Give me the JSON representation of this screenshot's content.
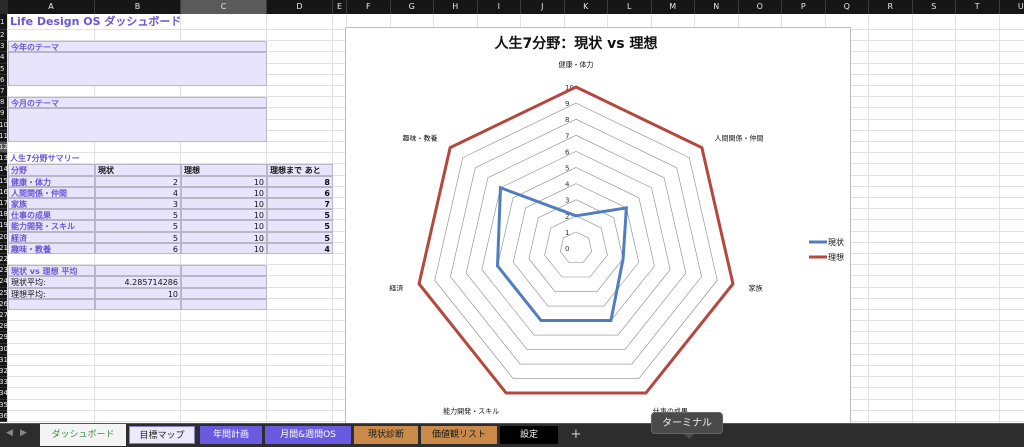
{
  "columns": [
    "A",
    "B",
    "C",
    "D",
    "E",
    "F",
    "G",
    "H",
    "I",
    "J",
    "K",
    "L",
    "M",
    "N",
    "O",
    "P",
    "Q",
    "R",
    "S",
    "T",
    "U"
  ],
  "title": "Life Design OS ダッシュボード",
  "year_theme": {
    "label": "今年のテーマ",
    "value": ""
  },
  "month_theme": {
    "label": "今月のテーマ",
    "value": ""
  },
  "summary": {
    "heading": "人生7分野サマリー",
    "headers": [
      "分野",
      "現状",
      "理想",
      "理想まで あと"
    ],
    "rows": [
      {
        "area": "健康・体力",
        "current": "2",
        "ideal": "10",
        "gap": "8"
      },
      {
        "area": "人間関係・仲間",
        "current": "4",
        "ideal": "10",
        "gap": "6"
      },
      {
        "area": "家族",
        "current": "3",
        "ideal": "10",
        "gap": "7"
      },
      {
        "area": "仕事の成果",
        "current": "5",
        "ideal": "10",
        "gap": "5"
      },
      {
        "area": "能力開発・スキル",
        "current": "5",
        "ideal": "10",
        "gap": "5"
      },
      {
        "area": "経済",
        "current": "5",
        "ideal": "10",
        "gap": "5"
      },
      {
        "area": "趣味・教養",
        "current": "6",
        "ideal": "10",
        "gap": "4"
      }
    ]
  },
  "averages": {
    "heading": "現状 vs 理想 平均",
    "current_label": "現状平均:",
    "current_value": "4.285714286",
    "ideal_label": "理想平均:",
    "ideal_value": "10"
  },
  "chart_data": {
    "type": "radar",
    "title": "人生7分野：現状 vs 理想",
    "categories": [
      "健康・体力",
      "人間関係・仲間",
      "家族",
      "仕事の成果",
      "能力開発・スキル",
      "経済",
      "趣味・教養"
    ],
    "series": [
      {
        "name": "現状",
        "values": [
          2,
          4,
          3,
          5,
          5,
          5,
          6
        ],
        "color": "#4f7dbf"
      },
      {
        "name": "理想",
        "values": [
          10,
          10,
          10,
          10,
          10,
          10,
          10
        ],
        "color": "#b5473f"
      }
    ],
    "range": [
      0,
      10
    ],
    "ticks": [
      "0",
      "1",
      "2",
      "3",
      "4",
      "5",
      "6",
      "7",
      "8",
      "9",
      "10"
    ],
    "legend": "right"
  },
  "tabs": [
    {
      "label": "ダッシュボード",
      "active": true
    },
    {
      "label": "目標マップ"
    },
    {
      "label": "年間計画"
    },
    {
      "label": "月間&週間OS"
    },
    {
      "label": "現状診断"
    },
    {
      "label": "価値観リスト"
    },
    {
      "label": "設定"
    }
  ],
  "add_tab": "+",
  "tooltip": "ターミナル"
}
